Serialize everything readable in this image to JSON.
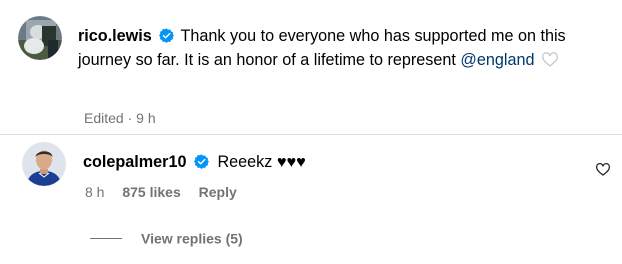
{
  "caption": {
    "username": "rico.lewis",
    "text_before_mention": "Thank you to everyone who has supported me on this journey so far. It is an honor of a lifetime to represent ",
    "mention": "@england",
    "meta": "Edited · 9 h",
    "like_icon": "heart-outline-icon"
  },
  "comment": {
    "username": "colepalmer10",
    "body": "Reeekz ♥♥♥",
    "time": "8 h",
    "likes": "875 likes",
    "reply_label": "Reply",
    "like_icon": "heart-outline-icon"
  },
  "view_replies": {
    "label": "View replies (5)"
  },
  "colors": {
    "verified_badge": "#0095f6",
    "mention": "#00376b",
    "secondary_text": "#737373"
  }
}
